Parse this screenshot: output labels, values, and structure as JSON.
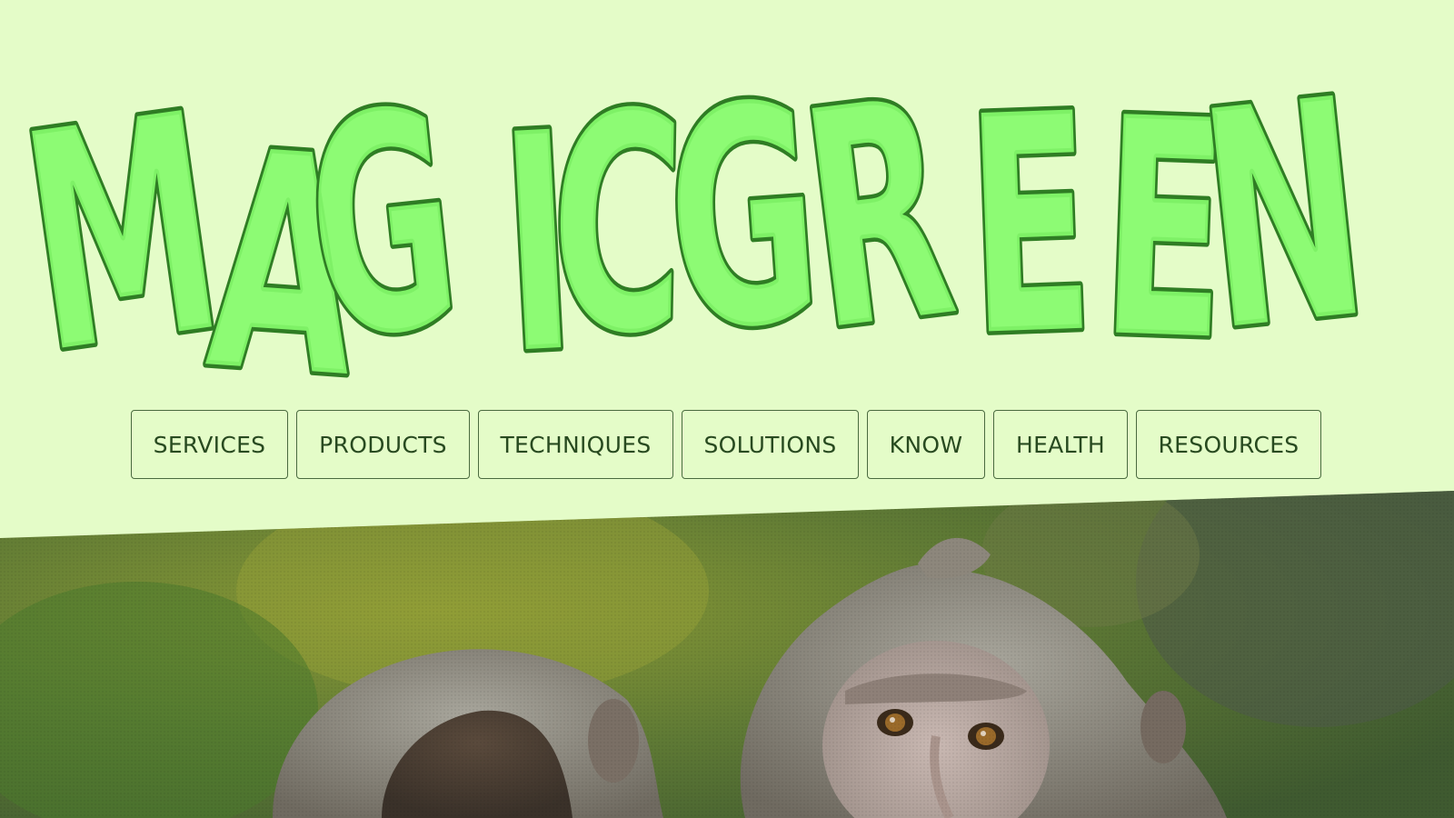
{
  "logo": {
    "letters": [
      "M",
      "A",
      "G",
      "I",
      "C",
      "G",
      "R",
      "E",
      "E",
      "N"
    ]
  },
  "nav": {
    "items": [
      {
        "label": "SERVICES"
      },
      {
        "label": "PRODUCTS"
      },
      {
        "label": "TECHNIQUES"
      },
      {
        "label": "SOLUTIONS"
      },
      {
        "label": "KNOW"
      },
      {
        "label": "HEALTH"
      },
      {
        "label": "RESOURCES"
      }
    ]
  },
  "colors": {
    "background": "#e4fcc8",
    "logo_fill": "#86fb6c",
    "logo_stroke": "#2f7d24",
    "nav_text": "#284a20",
    "nav_border": "#4a6a3f"
  },
  "hero": {
    "icon": "monkey-photo"
  }
}
